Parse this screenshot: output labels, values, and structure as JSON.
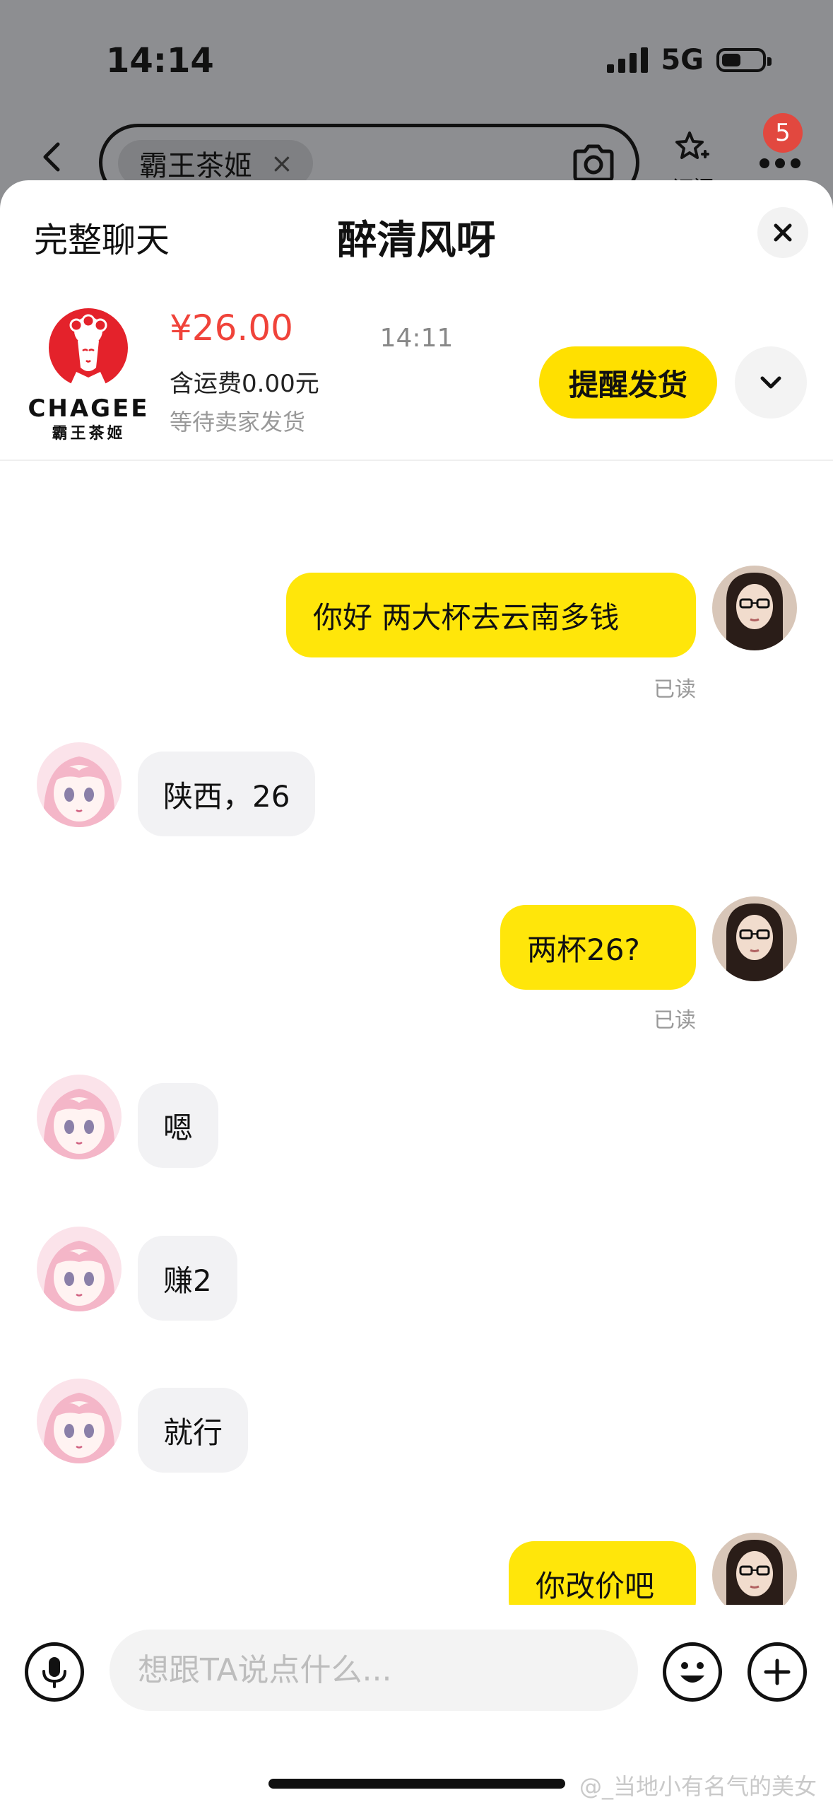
{
  "status_bar": {
    "time": "14:14",
    "network": "5G"
  },
  "top_nav": {
    "search_chip": "霸王茶姬",
    "subscribe_label": "订阅",
    "notification_count": "5"
  },
  "sheet": {
    "full_chat_label": "完整聊天",
    "title": "醉清风呀"
  },
  "order": {
    "logo_word": "CHAGEE",
    "logo_cn": "霸王茶姬",
    "price": "¥26.00",
    "shipping_fee": "含运费0.00元",
    "status": "等待卖家发货",
    "remind_button": "提醒发货"
  },
  "chat": {
    "timestamp": "14:11",
    "messages": [
      {
        "from": "me",
        "text": "你好 两大杯去云南多钱",
        "read": "已读"
      },
      {
        "from": "them",
        "text": "陕西，26"
      },
      {
        "from": "me",
        "text": "两杯26?",
        "read": "已读"
      },
      {
        "from": "them",
        "text": "嗯"
      },
      {
        "from": "them",
        "text": "赚2"
      },
      {
        "from": "them",
        "text": "就行"
      },
      {
        "from": "me",
        "text": "你改价吧"
      }
    ]
  },
  "input": {
    "placeholder": "想跟TA说点什么..."
  },
  "watermark": "@_当地小有名气的美女",
  "colors": {
    "accent_yellow": "#ffe60a",
    "price_red": "#f0433a",
    "badge_red": "#e2483f"
  }
}
